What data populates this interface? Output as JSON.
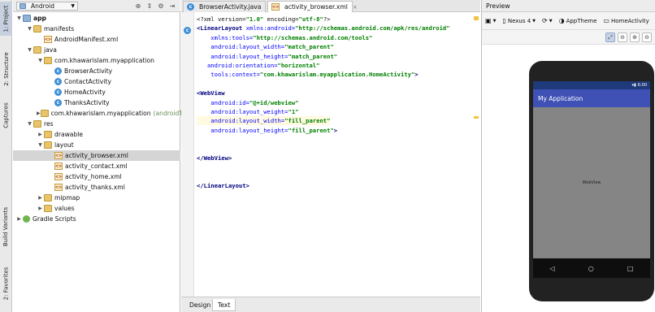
{
  "left_strip": {
    "tabs": [
      "1: Project",
      "2: Structure",
      "Captures",
      "Build Variants",
      "2: Favorites"
    ]
  },
  "project": {
    "view_selector": "Android",
    "toolbar_icons": [
      "chevron-down-icon",
      "target-icon",
      "sync-icon",
      "gear-icon",
      "hide-icon"
    ],
    "tree": [
      {
        "label": "app",
        "depth": 0,
        "icon": "folder-blue",
        "expanded": true,
        "bold": true
      },
      {
        "label": "manifests",
        "depth": 1,
        "icon": "folder",
        "expanded": true
      },
      {
        "label": "AndroidManifest.xml",
        "depth": 2,
        "icon": "xml"
      },
      {
        "label": "java",
        "depth": 1,
        "icon": "folder",
        "expanded": true
      },
      {
        "label": "com.khawarislam.myapplication",
        "depth": 2,
        "icon": "folder",
        "expanded": true
      },
      {
        "label": "BrowserActivity",
        "depth": 3,
        "icon": "class"
      },
      {
        "label": "ContactActivity",
        "depth": 3,
        "icon": "class"
      },
      {
        "label": "HomeActivity",
        "depth": 3,
        "icon": "class"
      },
      {
        "label": "ThanksActivity",
        "depth": 3,
        "icon": "class"
      },
      {
        "label": "com.khawarislam.myapplication",
        "suffix": "(androidTe",
        "depth": 2,
        "icon": "folder",
        "expanded": false
      },
      {
        "label": "res",
        "depth": 1,
        "icon": "folder",
        "expanded": true
      },
      {
        "label": "drawable",
        "depth": 2,
        "icon": "folder",
        "expanded": false
      },
      {
        "label": "layout",
        "depth": 2,
        "icon": "folder",
        "expanded": true
      },
      {
        "label": "activity_browser.xml",
        "depth": 3,
        "icon": "xml",
        "selected": true
      },
      {
        "label": "activity_contact.xml",
        "depth": 3,
        "icon": "xml"
      },
      {
        "label": "activity_home.xml",
        "depth": 3,
        "icon": "xml"
      },
      {
        "label": "activity_thanks.xml",
        "depth": 3,
        "icon": "xml"
      },
      {
        "label": "mipmap",
        "depth": 2,
        "icon": "folder",
        "expanded": false
      },
      {
        "label": "values",
        "depth": 2,
        "icon": "folder",
        "expanded": false
      },
      {
        "label": "Gradle Scripts",
        "depth": 0,
        "icon": "gradle",
        "expanded": false
      }
    ]
  },
  "editor": {
    "tabs": [
      {
        "label": "BrowserActivity.java",
        "icon": "class",
        "active": false
      },
      {
        "label": "activity_browser.xml",
        "icon": "xml",
        "active": true
      }
    ],
    "lines": [
      [
        [
          "<?xml version=",
          "plain"
        ],
        [
          "\"1.0\"",
          "val"
        ],
        [
          " encoding=",
          "plain"
        ],
        [
          "\"utf-8\"",
          "val"
        ],
        [
          "?>",
          "plain"
        ]
      ],
      [
        [
          "<LinearLayout ",
          "tag"
        ],
        [
          "xmlns:android=",
          "attr"
        ],
        [
          "\"http://schemas.android.com/apk/res/android\"",
          "val"
        ]
      ],
      [
        [
          "    xmlns:tools=",
          "attr"
        ],
        [
          "\"http://schemas.android.com/tools\"",
          "val"
        ]
      ],
      [
        [
          "    android:layout_width=",
          "attr"
        ],
        [
          "\"match_parent\"",
          "val"
        ]
      ],
      [
        [
          "    android:layout_height=",
          "attr"
        ],
        [
          "\"match_parent\"",
          "val"
        ]
      ],
      [
        [
          "   android:orientation=",
          "attr"
        ],
        [
          "\"horizontal\"",
          "val"
        ]
      ],
      [
        [
          "    tools:context=",
          "attr"
        ],
        [
          "\"com.khawarislam.myapplication.HomeActivity\"",
          "val"
        ],
        [
          ">",
          "tag"
        ]
      ],
      [],
      [
        [
          "<WebView",
          "tag"
        ]
      ],
      [
        [
          "    android:id=",
          "attr"
        ],
        [
          "\"@+id/webview\"",
          "val"
        ]
      ],
      [
        [
          "    android:layout_weight=",
          "attr"
        ],
        [
          "\"1\"",
          "val"
        ]
      ],
      [
        [
          "    android:layout_width=",
          "attr"
        ],
        [
          "\"fill_parent\"",
          "val"
        ]
      ],
      [
        [
          "    android:layout_height=",
          "attr"
        ],
        [
          "\"fill_parent\"",
          "val"
        ],
        [
          ">",
          "tag"
        ]
      ],
      [],
      [],
      [
        [
          "</WebView>",
          "tag"
        ]
      ],
      [],
      [],
      [
        [
          "</LinearLayout>",
          "tag"
        ]
      ]
    ],
    "bottom_tabs": [
      {
        "label": "Design",
        "active": false
      },
      {
        "label": "Text",
        "active": true
      }
    ]
  },
  "preview": {
    "title": "Preview",
    "device": "Nexus 4",
    "theme": "AppTheme",
    "activity": "HomeActivity",
    "phone": {
      "time": "6:00",
      "app_title": "My Application",
      "content_label": "WebView",
      "nav": [
        "◁",
        "○",
        "□"
      ]
    }
  },
  "colors": {
    "action_bar": "#3f51b5",
    "status_bar": "#1f3a7a"
  }
}
